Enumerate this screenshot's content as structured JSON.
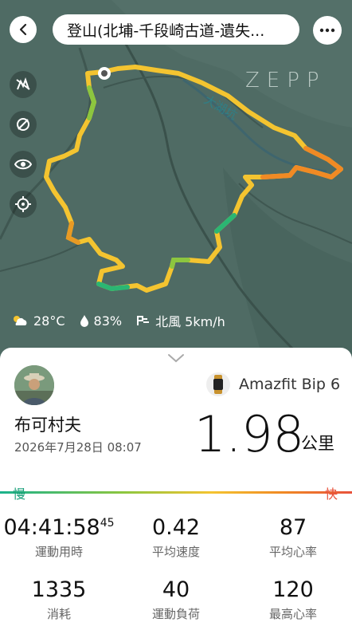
{
  "header": {
    "title": "登山(北埔-千段崎古道-遺失..."
  },
  "map": {
    "watermark": "ZEPP",
    "river_label": "大湖坑",
    "weather": {
      "temperature": "28°C",
      "humidity": "83%",
      "wind": "北風 5km/h"
    }
  },
  "workout": {
    "user_name": "布可村夫",
    "datetime": "2026年7月28日 08:07",
    "device": "Amazfit Bip 6",
    "distance": "1.98",
    "distance_unit": "公里",
    "pace_slow_label": "慢",
    "pace_fast_label": "快"
  },
  "stats": [
    {
      "value": "04:41:58",
      "sub": "45",
      "label": "運動用時"
    },
    {
      "value": "0.42",
      "label": "平均速度"
    },
    {
      "value": "87",
      "label": "平均心率"
    },
    {
      "value": "1335",
      "label": "消耗"
    },
    {
      "value": "40",
      "label": "運動負荷"
    },
    {
      "value": "120",
      "label": "最高心率"
    }
  ],
  "colors": {
    "map_background": "#4f6b64",
    "track_start": "#f4c430",
    "track_slow": "#8cc63f",
    "track_fast": "#f08a24",
    "pace_slow": "#1aa07a",
    "pace_fast": "#e8523b"
  },
  "icons": [
    "back-icon",
    "more-icon",
    "layers-off-icon",
    "satellite-off-icon",
    "eye-icon",
    "locate-icon",
    "weather-icon",
    "humidity-icon",
    "wind-icon",
    "avatar",
    "watch-icon",
    "chevron-down-icon"
  ]
}
